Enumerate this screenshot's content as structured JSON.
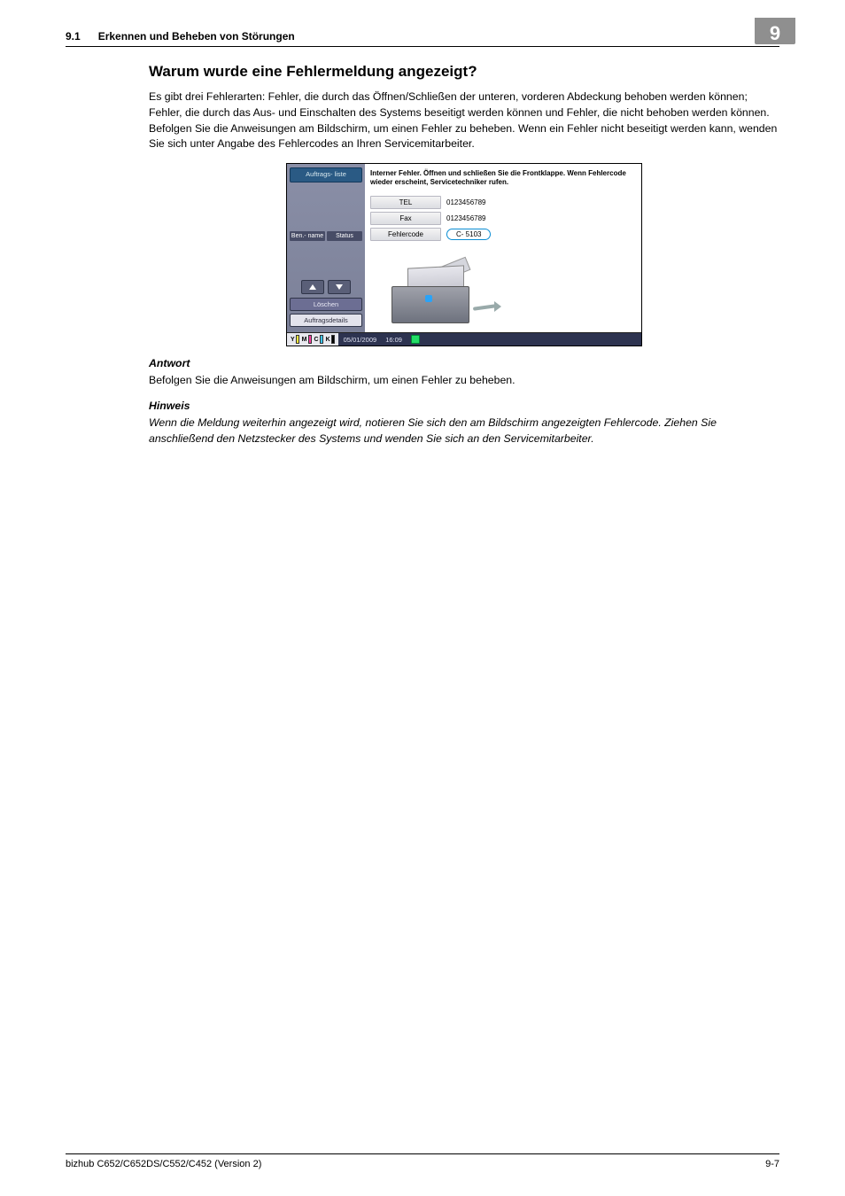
{
  "header": {
    "section_num": "9.1",
    "section_title": "Erkennen und Beheben von Störungen",
    "chapter_tab": "9"
  },
  "content": {
    "heading": "Warum wurde eine Fehlermeldung angezeigt?",
    "intro": "Es gibt drei Fehlerarten: Fehler, die durch das Öffnen/Schließen der unteren, vorderen Abdeckung behoben werden können; Fehler, die durch das Aus- und Einschalten des Systems beseitigt werden können und Fehler, die nicht behoben werden können. Befolgen Sie die Anweisungen am Bildschirm, um einen Fehler zu beheben. Wenn ein Fehler nicht beseitigt werden kann, wenden Sie sich unter Angabe des Fehlercodes an Ihren Servicemitarbeiter.",
    "antwort_label": "Antwort",
    "antwort_text": "Befolgen Sie die Anweisungen am Bildschirm, um einen Fehler zu beheben.",
    "hinweis_label": "Hinweis",
    "hinweis_text": "Wenn die Meldung weiterhin angezeigt wird, notieren Sie sich den am Bildschirm angezeigten Fehlercode. Ziehen Sie anschließend den Netzstecker des Systems und wenden Sie sich an den Servicemitarbeiter."
  },
  "device": {
    "sidebar": {
      "joblist": "Auftrags-\nliste",
      "col_user": "Ben.-\nname",
      "col_status": "Status",
      "delete": "Löschen",
      "details": "Auftragsdetails"
    },
    "main": {
      "message": "Interner Fehler. Öffnen und schließen Sie die Frontklappe. Wenn Fehlercode wieder erscheint, Servicetechniker rufen.",
      "tel_label": "TEL",
      "tel_val": "0123456789",
      "fax_label": "Fax",
      "fax_val": "0123456789",
      "code_label": "Fehlercode",
      "code_val": "C- 5103"
    },
    "status": {
      "date": "05/01/2009",
      "time": "16:09",
      "toner_y": "Y",
      "toner_m": "M",
      "toner_c": "C",
      "toner_k": "K"
    }
  },
  "footer": {
    "left": "bizhub C652/C652DS/C552/C452 (Version 2)",
    "right": "9-7"
  }
}
